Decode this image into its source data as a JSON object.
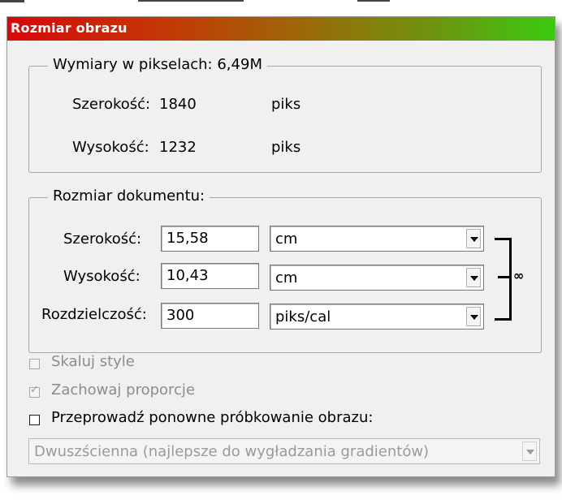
{
  "dialog": {
    "title": "Rozmiar obrazu"
  },
  "pixel_dimensions": {
    "legend": "Wymiary w pikselach:",
    "value": "6,49M",
    "width_label": "Szerokość:",
    "width_value": "1840",
    "width_unit": "piks",
    "height_label": "Wysokość:",
    "height_value": "1232",
    "height_unit": "piks"
  },
  "document_size": {
    "legend": "Rozmiar dokumentu:",
    "width_label": "Szerokość:",
    "width_value": "15,58",
    "width_unit": "cm",
    "height_label": "Wysokość:",
    "height_value": "10,43",
    "height_unit": "cm",
    "resolution_label": "Rozdzielczość:",
    "resolution_value": "300",
    "resolution_unit": "piks/cal",
    "link_icon": "chain-link-icon"
  },
  "options": {
    "scale_styles": {
      "label": "Skaluj style",
      "checked": false,
      "enabled": false
    },
    "constrain_proportions": {
      "label": "Zachowaj proporcje",
      "checked": true,
      "enabled": false
    },
    "resample": {
      "label": "Przeprowadź ponowne próbkowanie obrazu:",
      "checked": false,
      "enabled": true
    },
    "resample_method": "Dwuszścienna (najlepsze do wygładzania gradientów)"
  }
}
